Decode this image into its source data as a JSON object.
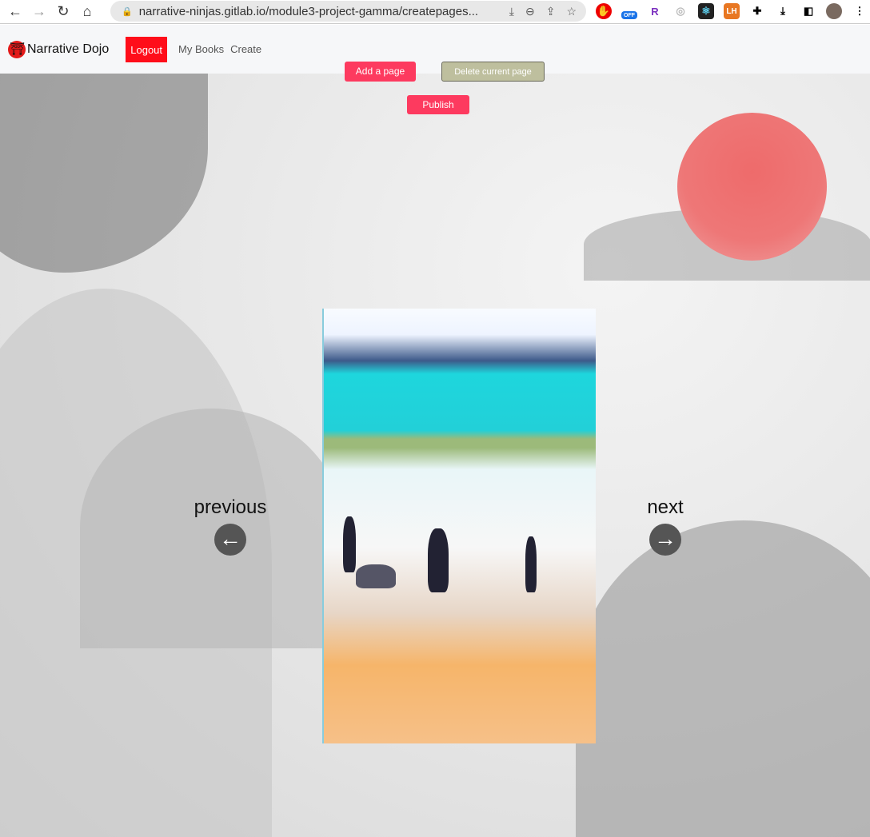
{
  "browser": {
    "url": "narrative-ninjas.gitlab.io/module3-project-gamma/createpages...",
    "extension_off_badge": "OFF"
  },
  "navbar": {
    "brand": "Narrative Dojo",
    "logout": "Logout",
    "links": [
      "My Books",
      "Create"
    ]
  },
  "actions": {
    "add_page": "Add a page",
    "delete_page": "Delete current page",
    "publish": "Publish"
  },
  "pager": {
    "previous": "previous",
    "next": "next"
  },
  "colors": {
    "primary_button": "#fd3a5f",
    "logout": "#ff0d1a",
    "delete_button": "#bebf9e"
  }
}
